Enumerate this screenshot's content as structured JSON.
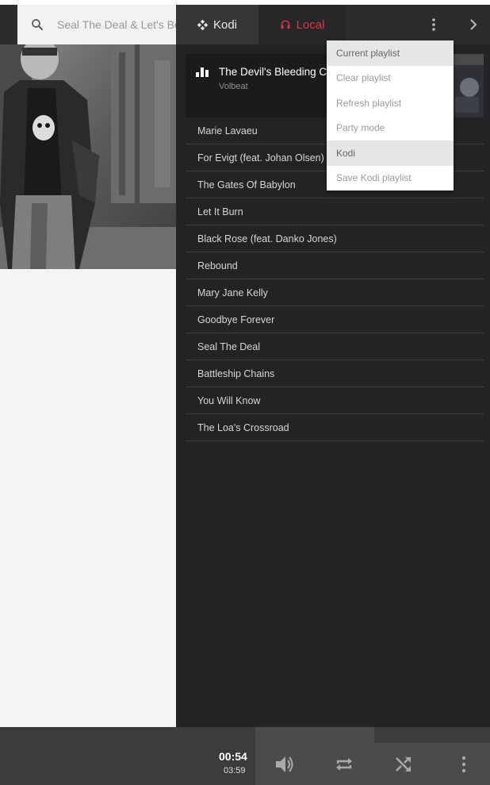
{
  "search": {
    "placeholder": "Seal The Deal & Let's Boogie",
    "icon": "search-icon"
  },
  "tabs": [
    {
      "label": "Kodi",
      "icon": "kodi-icon",
      "active": false
    },
    {
      "label": "Local",
      "icon": "headphones-icon",
      "active": true
    }
  ],
  "header": {
    "menu_icon": "more-vertical-icon",
    "chevron_icon": "chevron-right-icon"
  },
  "colors": {
    "accent": "#e5304a",
    "header_bg": "#2b2c2e",
    "panel_bg": "#222325"
  },
  "now_playing": {
    "title": "The Devil's Bleeding Crown",
    "artist": "Volbeat",
    "icon": "equalizer-icon"
  },
  "playlist": {
    "items": [
      "Marie Lavaeu",
      "For Evigt (feat. Johan Olsen)",
      "The Gates Of Babylon",
      "Let It Burn",
      "Black Rose (feat. Danko Jones)",
      "Rebound",
      "Mary Jane Kelly",
      "Goodbye Forever",
      "Seal The Deal",
      "Battleship Chains",
      "You Will Know",
      "The Loa's Crossroad"
    ]
  },
  "menu": {
    "items": [
      {
        "label": "Current playlist",
        "active": true
      },
      {
        "label": "Clear playlist",
        "active": false
      },
      {
        "label": "Refresh playlist",
        "active": false
      },
      {
        "label": "Party mode",
        "active": false
      },
      {
        "label": "Kodi",
        "active": true
      },
      {
        "label": "Save Kodi playlist",
        "active": false
      }
    ]
  },
  "player": {
    "current_time": "00:54",
    "total_time": "03:59",
    "controls": [
      "volume-icon",
      "repeat-icon",
      "shuffle-icon",
      "more-vertical-icon"
    ]
  }
}
